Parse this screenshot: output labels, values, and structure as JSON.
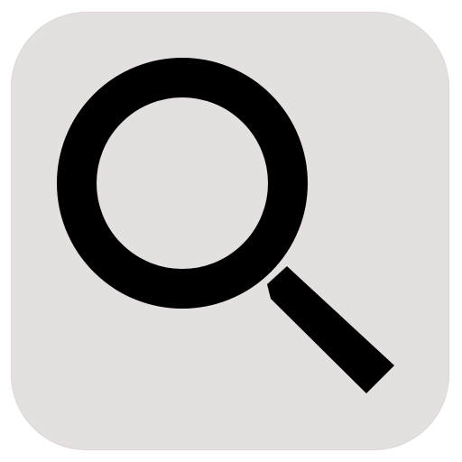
{
  "app_icon": {
    "icon": "search-icon",
    "background_color": "#e5e0e0",
    "glyph_color": "#000000"
  }
}
